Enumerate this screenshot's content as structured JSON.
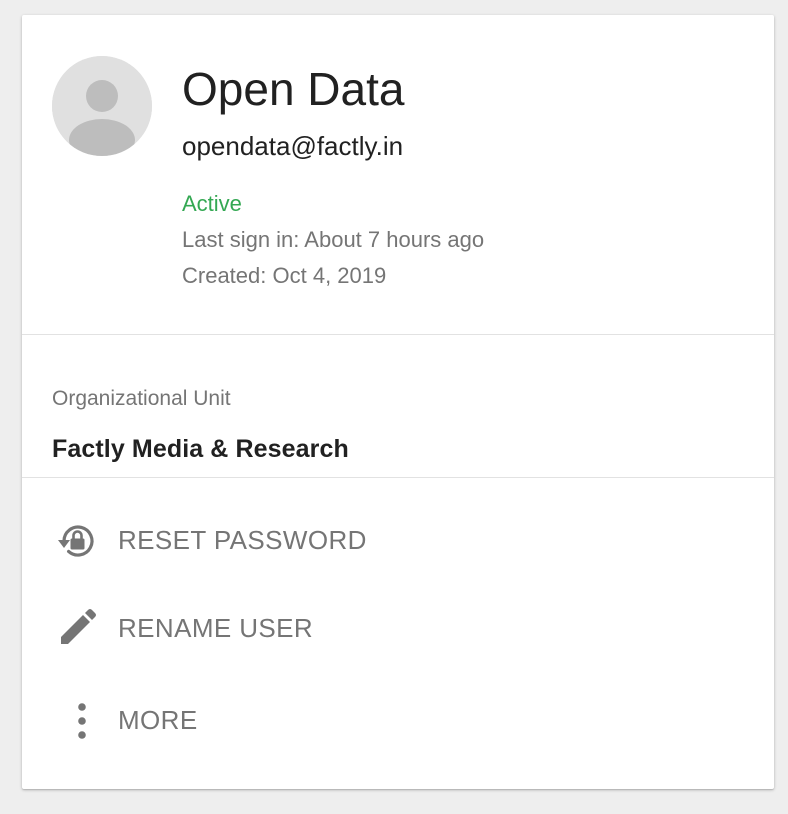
{
  "user": {
    "name": "Open Data",
    "email": "opendata@factly.in",
    "status": "Active",
    "last_sign_in": "Last sign in: About 7 hours ago",
    "created": "Created: Oct 4, 2019"
  },
  "org": {
    "label": "Organizational Unit",
    "value": "Factly Media & Research"
  },
  "actions": [
    {
      "label": "RESET PASSWORD",
      "icon": "lock-reset-icon"
    },
    {
      "label": "RENAME USER",
      "icon": "pencil-icon"
    },
    {
      "label": "MORE",
      "icon": "more-vertical-icon"
    }
  ],
  "colors": {
    "status_active": "#34a853",
    "secondary_text": "#757575",
    "primary_text": "#212121",
    "avatar_bg": "#e0e0e0",
    "avatar_fg": "#bdbdbd"
  }
}
